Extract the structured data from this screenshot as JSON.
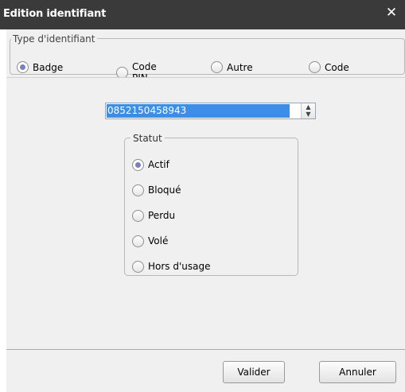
{
  "window": {
    "title": "Edition identifiant",
    "close_glyph": "✕"
  },
  "type_group": {
    "legend": "Type d'identifiant",
    "options": [
      {
        "label": "Badge",
        "checked": true
      },
      {
        "label": "Code PIN",
        "checked": false
      },
      {
        "label": "Autre",
        "checked": false
      },
      {
        "label": "Code",
        "checked": false
      }
    ]
  },
  "identifier": {
    "value": "0852150458943",
    "spin_up": "▲",
    "spin_down": "▼"
  },
  "statut": {
    "legend": "Statut",
    "options": [
      {
        "label": "Actif",
        "checked": true
      },
      {
        "label": "Bloqué",
        "checked": false
      },
      {
        "label": "Perdu",
        "checked": false
      },
      {
        "label": "Volé",
        "checked": false
      },
      {
        "label": "Hors d'usage",
        "checked": false
      }
    ]
  },
  "footer": {
    "validate_label": "Valider",
    "cancel_label": "Annuler"
  },
  "colors": {
    "titlebar": "#3a3a3a",
    "radio_selected": "#7b7fbf",
    "selection": "#3c8ee6"
  }
}
